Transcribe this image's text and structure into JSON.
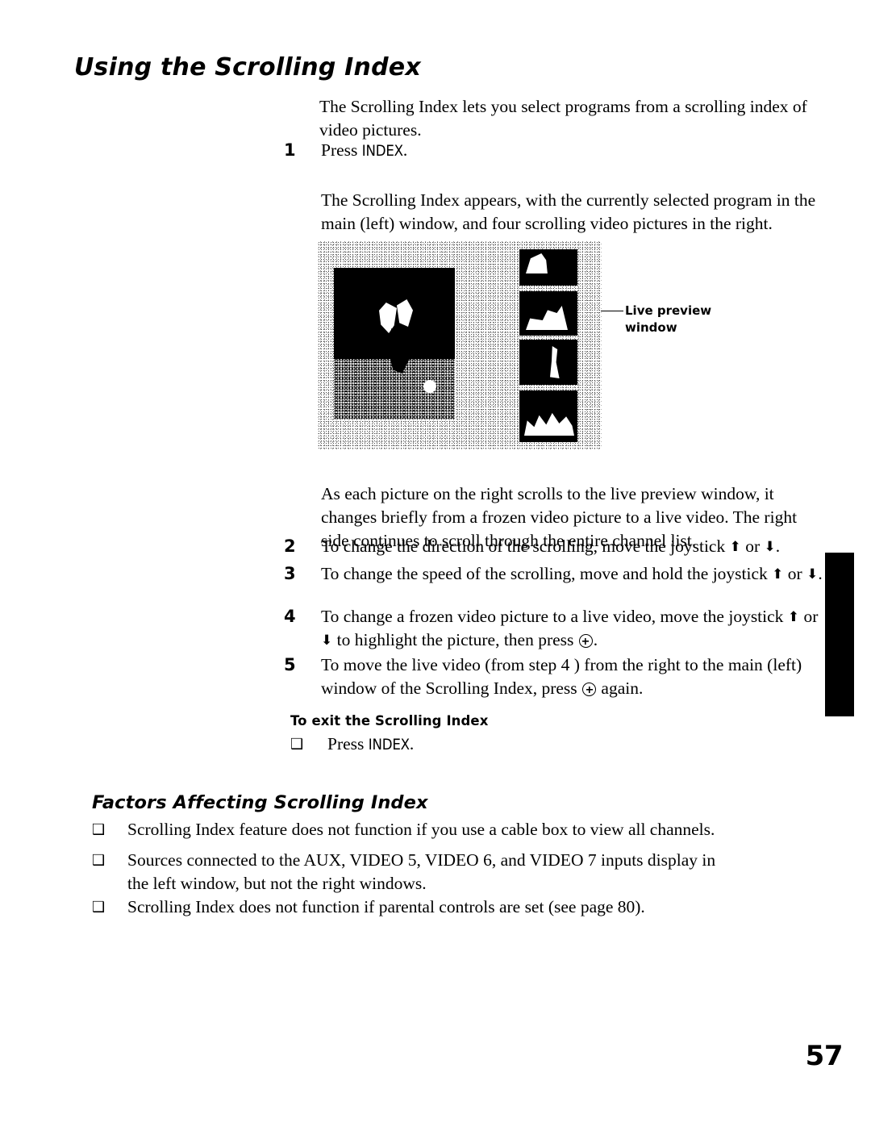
{
  "document": {
    "page_number": "57",
    "section_title": "Using the Scrolling Index",
    "subsection_title": "Factors Affecting Scrolling Index"
  },
  "intro": {
    "text": "The Scrolling Index lets you select programs from a scrolling index of video pictures."
  },
  "steps": [
    {
      "number": "1",
      "lead_a": "Press ",
      "keyword": "INDEX",
      "lead_b": ".",
      "detail": "The Scrolling Index appears, with the currently selected program in the main (left) window, and four scrolling video pictures in the right."
    },
    {
      "number": "2",
      "text_a": "To change the direction of the scrolling, move the joystick ",
      "arrow_up": "⬆",
      "mid": " or ",
      "arrow_down": "⬇",
      "text_b": "."
    },
    {
      "number": "3",
      "text_a": "To change the speed of the scrolling, move and hold the joystick ",
      "arrow_up": "⬆",
      "mid": " or ",
      "arrow_down": "⬇",
      "text_b": "."
    },
    {
      "number": "4",
      "text_a": "To change a frozen video picture to a live video, move the joystick ",
      "arrow_up": "⬆",
      "mid": " or ",
      "arrow_down": "⬇",
      "text_b": " to highlight the picture, then press ",
      "text_c": "."
    },
    {
      "number": "5",
      "text_a": "To move the live video (from step 4 ) from the right to the main (left) window of the Scrolling Index, press ",
      "text_b": " again."
    }
  ],
  "figure_caption": {
    "text": "As each picture on the right scrolls to the live preview window, it changes briefly from a frozen video picture to a live video. The right side continues to scroll through the entire channel list."
  },
  "figure": {
    "callout_label": "Live preview\nwindow",
    "description": "Scrolling Index on-screen display: large main video window at left with four scrolling thumbnail video pictures stacked at right"
  },
  "exit_section": {
    "heading": "To exit the Scrolling Index",
    "bullet_glyph": "❑",
    "item_a": "Press ",
    "item_keyword": "INDEX",
    "item_b": "."
  },
  "factors": {
    "bullet_glyph": "❑",
    "items": [
      "Scrolling Index feature does not function if you use a cable box to view all channels.",
      "Sources connected to the AUX, VIDEO 5, VIDEO 6, and VIDEO 7 inputs display in the left window, but not the right windows.",
      "Scrolling Index does not function if parental controls are set (see page 80)."
    ]
  },
  "colors": {
    "text": "#000000",
    "background": "#ffffff",
    "tab_marker": "#000000"
  },
  "icons": {
    "select_button": "circle-with-crosshair",
    "arrow_up": "solid-up-arrow",
    "arrow_down": "solid-down-arrow",
    "bullet": "hollow-square"
  }
}
